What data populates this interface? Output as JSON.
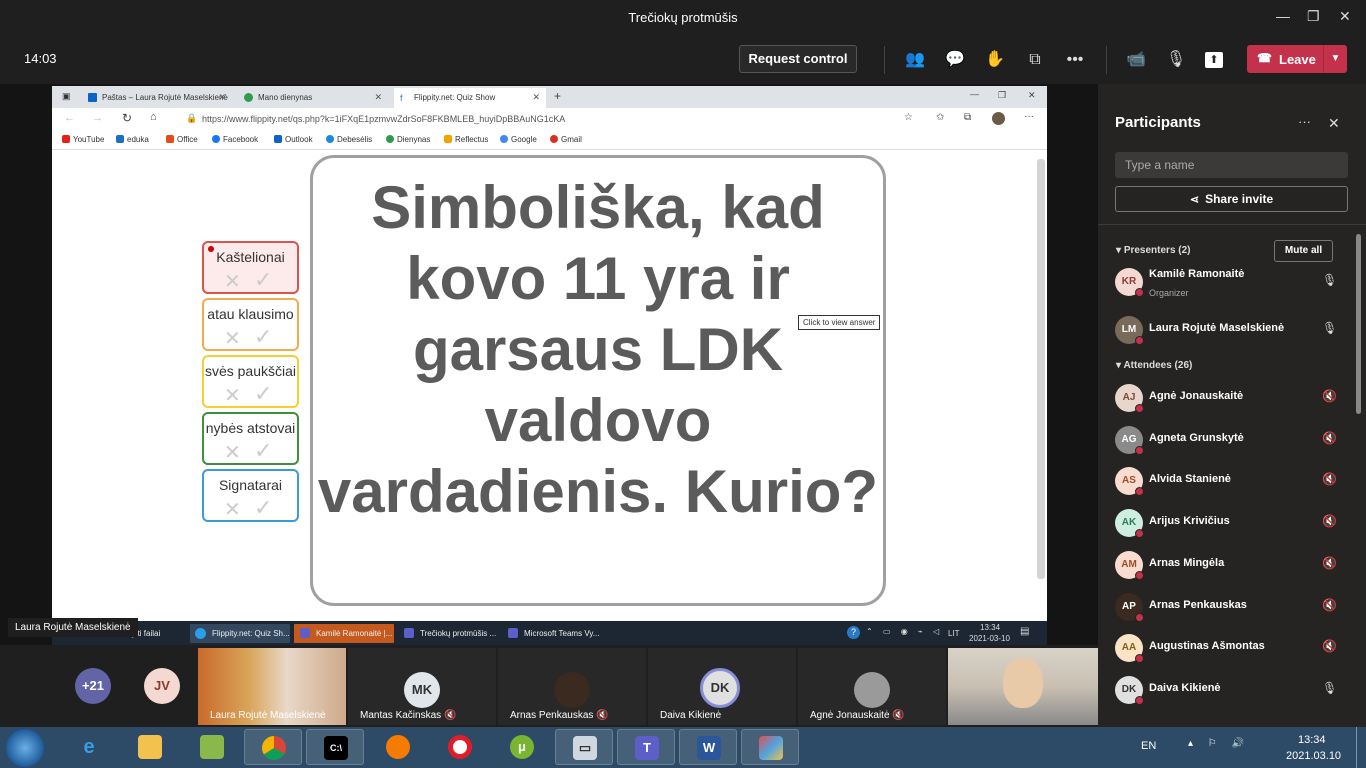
{
  "window": {
    "title": "Trečiokų protmūšis"
  },
  "meeting": {
    "time": "14:03",
    "request_control": "Request control",
    "leave": "Leave"
  },
  "browser": {
    "tabs": [
      {
        "label": "Paštas – Laura Rojutė Maselskienė"
      },
      {
        "label": "Mano dienynas"
      },
      {
        "label": "Flippity.net: Quiz Show"
      }
    ],
    "url": "https://www.flippity.net/qs.php?k=1iFXqE1pzmvwZdrSoF8FKBMLEB_huyiDpBBAuNG1cKA",
    "favorites": [
      "YouTube",
      "eduka",
      "Office",
      "Facebook",
      "Outlook",
      "Debesėlis",
      "Dienynas",
      "Reflectus",
      "Google",
      "Gmail"
    ],
    "categories": [
      {
        "label": "Kaštelionai",
        "color": "#d9534f"
      },
      {
        "label": "atau klausimo",
        "color": "#f0ad4e"
      },
      {
        "label": "svės paukščiai",
        "color": "#f5d033"
      },
      {
        "label": "nybės atstovai",
        "color": "#3f8f3f"
      },
      {
        "label": "Signatarai",
        "color": "#3a9bd5"
      }
    ],
    "question": "Simboliška, kad kovo 11 yra ir garsaus LDK valdovo vardadienis. Kurio?",
    "tooltip": "Click to view answer"
  },
  "inner_taskbar": {
    "items": [
      "Atsisiųsti failai",
      "Flippity.net: Quiz Sh...",
      "Kamilė Ramonaitė |...",
      "Trečiokų protmūšis ...",
      "Microsoft Teams Vy..."
    ],
    "lang": "LIT",
    "time": "13:34",
    "date": "2021-03-10"
  },
  "presenter_label": "Laura Rojutė Maselskienė",
  "participants": {
    "title": "Participants",
    "search_placeholder": "Type a name",
    "share_invite": "Share invite",
    "presenters_header": "Presenters (2)",
    "mute_all": "Mute all",
    "presenters": [
      {
        "initials": "KR",
        "name": "Kamilė Ramonaitė",
        "role": "Organizer",
        "bg": "#f4d9d3",
        "fg": "#8a3b2c"
      },
      {
        "initials": "LM",
        "name": "Laura Rojutė Maselskienė",
        "role": "",
        "bg": "#7a6a5a",
        "fg": "#fff"
      }
    ],
    "attendees_header": "Attendees (26)",
    "attendees": [
      {
        "initials": "AJ",
        "name": "Agnė Jonauskaitė",
        "bg": "#e8d5cc",
        "fg": "#7a4a3a"
      },
      {
        "initials": "AG",
        "name": "Agneta Grunskytė",
        "bg": "#8a8a8a",
        "fg": "#fff"
      },
      {
        "initials": "AS",
        "name": "Alvida Stanienė",
        "bg": "#f8dccf",
        "fg": "#a14b2a"
      },
      {
        "initials": "AK",
        "name": "Arijus Krivičius",
        "bg": "#cdeee0",
        "fg": "#2e7a5a"
      },
      {
        "initials": "AM",
        "name": "Arnas Mingėla",
        "bg": "#f8dccf",
        "fg": "#a14b2a"
      },
      {
        "initials": "AP",
        "name": "Arnas Penkauskas",
        "bg": "#3a2a20",
        "fg": "#fff"
      },
      {
        "initials": "AA",
        "name": "Augustinas Ašmontas",
        "bg": "#fbe3c5",
        "fg": "#8a5a1a"
      },
      {
        "initials": "DK",
        "name": "Daiva Kikienė",
        "bg": "#e0e0e0",
        "fg": "#333"
      }
    ]
  },
  "gallery": {
    "overflow": "+21",
    "jv": "JV",
    "tiles": [
      {
        "name": "Laura Rojutė Maselskienė"
      },
      {
        "initials": "MK",
        "name": "Mantas Kačinskas"
      },
      {
        "name": "Arnas Penkauskas"
      },
      {
        "initials": "DK",
        "name": "Daiva Kikienė"
      },
      {
        "name": "Agnė Jonauskaitė"
      }
    ]
  },
  "win_taskbar": {
    "lang": "EN",
    "time": "13:34",
    "date": "2021.03.10"
  }
}
